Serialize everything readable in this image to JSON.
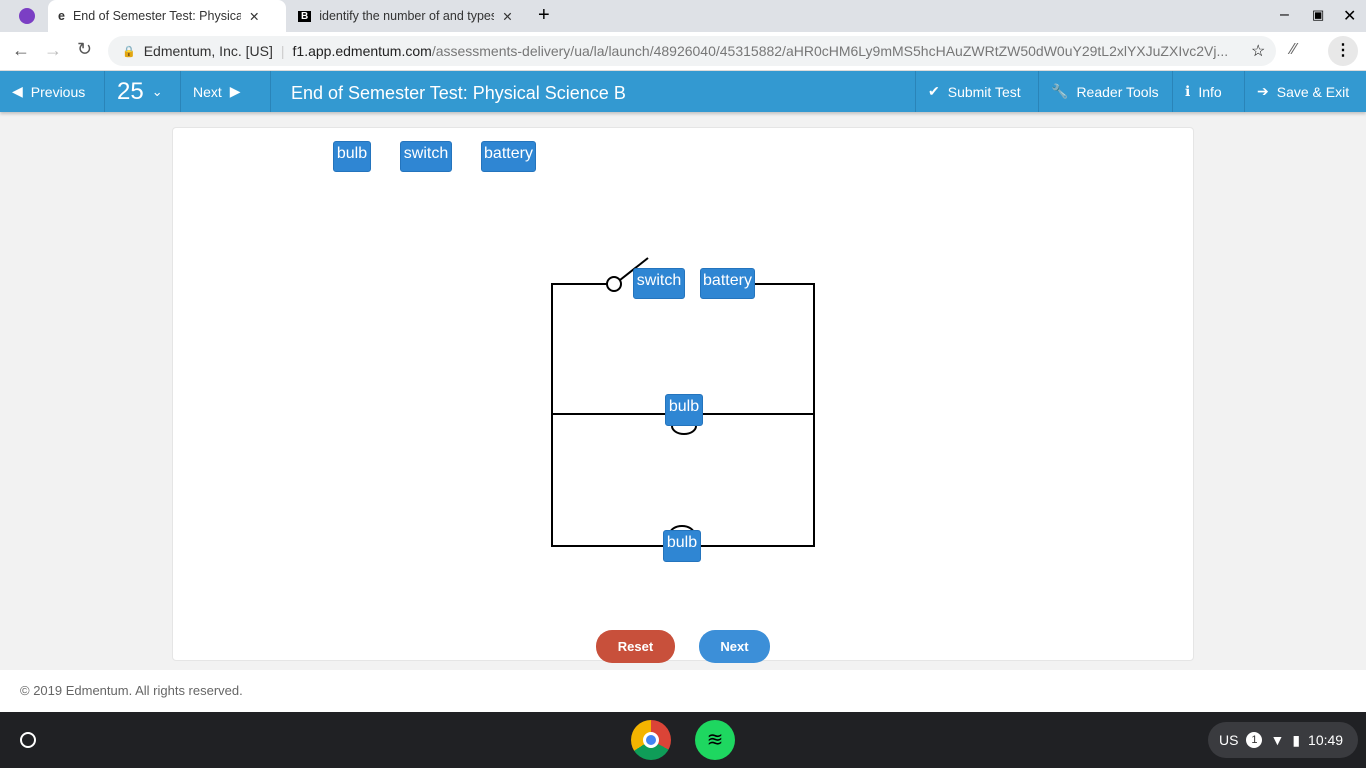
{
  "browser": {
    "tabs": [
      {
        "label": "End of Semester Test: Physical S",
        "active": true
      },
      {
        "label": "identify the number of and types",
        "active": false
      }
    ],
    "site_identity": "Edmentum, Inc. [US]",
    "url_host": "f1.app.edmentum.com",
    "url_path": "/assessments-delivery/ua/la/launch/48926040/45315882/aHR0cHM6Ly9mMS5hcHAuZWRtZW50dW0uY29tL2xlYXJuZXIvc2Vj..."
  },
  "toolbar": {
    "previous": "Previous",
    "question_number": "25",
    "next": "Next",
    "title": "End of Semester Test: Physical Science B",
    "submit": "Submit Test",
    "reader_tools": "Reader Tools",
    "info": "Info",
    "save_exit": "Save & Exit"
  },
  "tray": {
    "items": [
      "bulb",
      "switch",
      "battery"
    ]
  },
  "circuit": {
    "switch": "switch",
    "battery": "battery",
    "bulb1": "bulb",
    "bulb2": "bulb"
  },
  "actions": {
    "reset": "Reset",
    "next": "Next"
  },
  "footer": "© 2019 Edmentum. All rights reserved.",
  "taskbar": {
    "locale": "US",
    "notifications": "1",
    "time": "10:49"
  },
  "colors": {
    "accent": "#3399d1",
    "chip": "#2f86d3",
    "reset": "#c8503b",
    "next": "#3c8fd8"
  }
}
